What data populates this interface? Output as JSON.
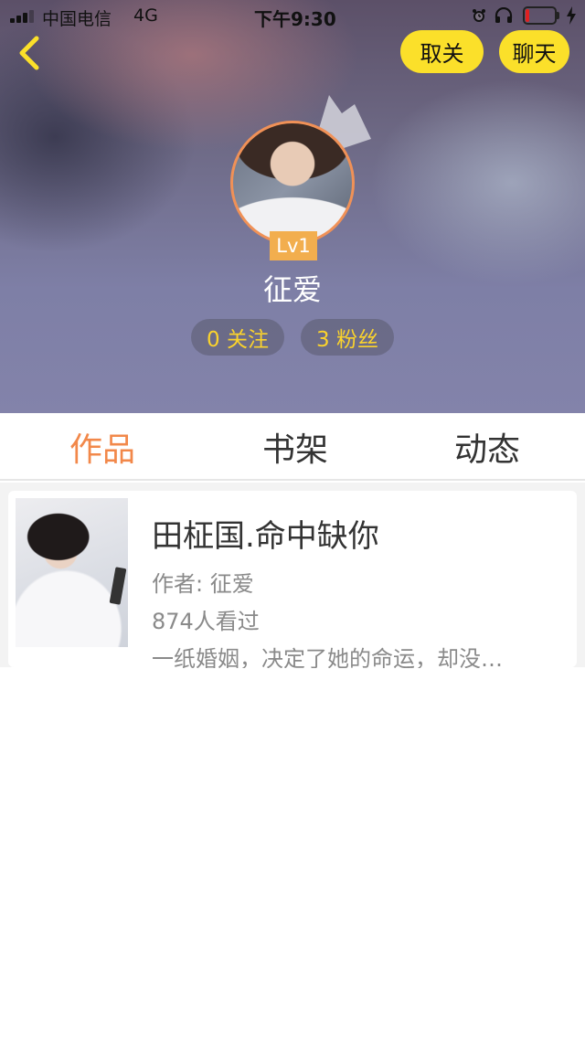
{
  "status_bar": {
    "carrier": "中国电信",
    "network": "4G",
    "time": "下午9:30",
    "battery_level": 0.12
  },
  "nav": {
    "unfollow_label": "取关",
    "chat_label": "聊天"
  },
  "profile": {
    "level": "Lv1",
    "username": "征爱",
    "following": "0 关注",
    "fans": "3 粉丝"
  },
  "tabs": [
    {
      "label": "作品",
      "active": true
    },
    {
      "label": "书架",
      "active": false
    },
    {
      "label": "动态",
      "active": false
    }
  ],
  "works": [
    {
      "title": "田柾国.命中缺你",
      "author": "作者: 征爱",
      "views": "874人看过",
      "description": "一纸婚姻，决定了她的命运，却没…"
    }
  ],
  "colors": {
    "accent": "#f2884a",
    "button_yellow": "#fbe02a",
    "level_badge": "#f2ae4e",
    "stat_text": "#fbd32c"
  },
  "icons": {
    "back": "back-chevron-icon",
    "crown": "crown-icon",
    "alarm": "alarm-icon",
    "headphones": "headphones-icon",
    "battery": "battery-icon",
    "charging": "charging-bolt-icon"
  }
}
